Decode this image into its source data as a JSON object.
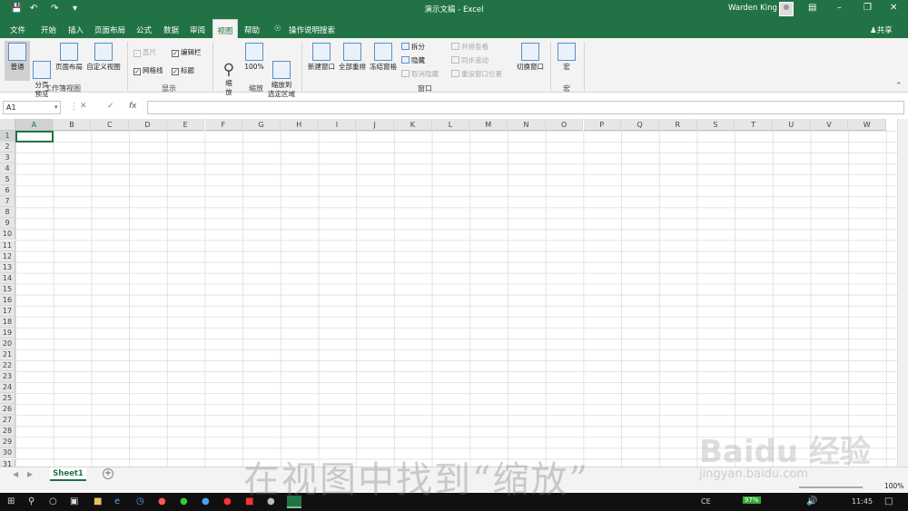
{
  "titlebar": {
    "title": "演示文稿 - Excel",
    "user": "Warden King"
  },
  "tabs": [
    "文件",
    "开始",
    "插入",
    "页面布局",
    "公式",
    "数据",
    "审阅",
    "视图",
    "帮助"
  ],
  "tell_me": "操作说明搜索",
  "share": "共享",
  "ribbon": {
    "views": {
      "normal": "普通",
      "page_break": "分页\n预览",
      "page_layout": "页面布局",
      "custom": "自定义视图",
      "label": "工作簿视图"
    },
    "show": {
      "ruler": "直尺",
      "formula_bar": "编辑栏",
      "gridlines": "网格线",
      "headings": "标题",
      "label": "显示"
    },
    "zoom": {
      "zoom": "缩\n放",
      "hundred": "100%",
      "to_selection": "缩放到\n选定区域",
      "label": "缩放"
    },
    "window": {
      "new": "新建窗口",
      "arrange": "全部重排",
      "freeze": "冻结窗格",
      "split": "拆分",
      "hide": "隐藏",
      "unhide": "取消隐藏",
      "side_by_side": "并排查看",
      "sync": "同步滚动",
      "reset": "重设窗口位置",
      "switch": "切换窗口",
      "label": "窗口"
    },
    "macros": {
      "macro": "宏",
      "label": "宏"
    }
  },
  "namebox": "A1",
  "fx": "fx",
  "columns": [
    "A",
    "B",
    "C",
    "D",
    "E",
    "F",
    "G",
    "H",
    "I",
    "J",
    "K",
    "L",
    "M",
    "N",
    "O",
    "P",
    "Q",
    "R",
    "S",
    "T",
    "U",
    "V",
    "W"
  ],
  "rows": [
    "1",
    "2",
    "3",
    "4",
    "5",
    "6",
    "7",
    "8",
    "9",
    "10",
    "11",
    "12",
    "13",
    "14",
    "15",
    "16",
    "17",
    "18",
    "19",
    "20",
    "21",
    "22",
    "23",
    "24",
    "25",
    "26",
    "27",
    "28",
    "29",
    "30",
    "31"
  ],
  "sheet": {
    "name": "Sheet1",
    "add": "+"
  },
  "status": {
    "zoom": "100%"
  },
  "taskbar": {
    "battery": "97%",
    "time": "11:45",
    "ime": "CE"
  },
  "watermark": {
    "caption": "在视图中找到“缩放”",
    "logo": "Baidu 经验",
    "url": "jingyan.baidu.com"
  }
}
